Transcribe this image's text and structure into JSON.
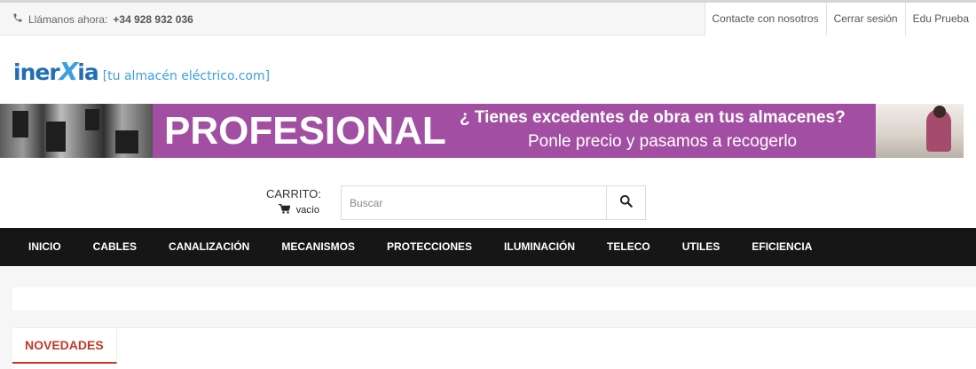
{
  "topbar": {
    "phone_prefix": "Llámanos ahora:",
    "phone_number": "+34 928 932 036",
    "links": [
      "Contacte con nosotros",
      "Cerrar sesión",
      "Edu Prueba"
    ]
  },
  "logo": {
    "brand_a": "iner",
    "brand_x": "X",
    "brand_b": "ia",
    "tagline": "[tu almacén eléctrico.com]"
  },
  "banner": {
    "headline": "PROFESIONAL",
    "line1": "¿ Tienes excedentes de obra en tus almacenes?",
    "line2": "Ponle precio y pasamos a recogerlo",
    "accent_color": "#a24ea2"
  },
  "cart": {
    "title": "CARRITO:",
    "state": "vacío"
  },
  "search": {
    "placeholder": "Buscar"
  },
  "nav": {
    "items": [
      "INICIO",
      "CABLES",
      "CANALIZACIÓN",
      "MECANISMOS",
      "PROTECCIONES",
      "ILUMINACIÓN",
      "TELECO",
      "UTILES",
      "EFICIENCIA"
    ]
  },
  "tabs": {
    "active": "NOVEDADES"
  },
  "icons": {
    "phone": "phone-icon",
    "cart": "cart-icon",
    "search": "search-icon"
  }
}
